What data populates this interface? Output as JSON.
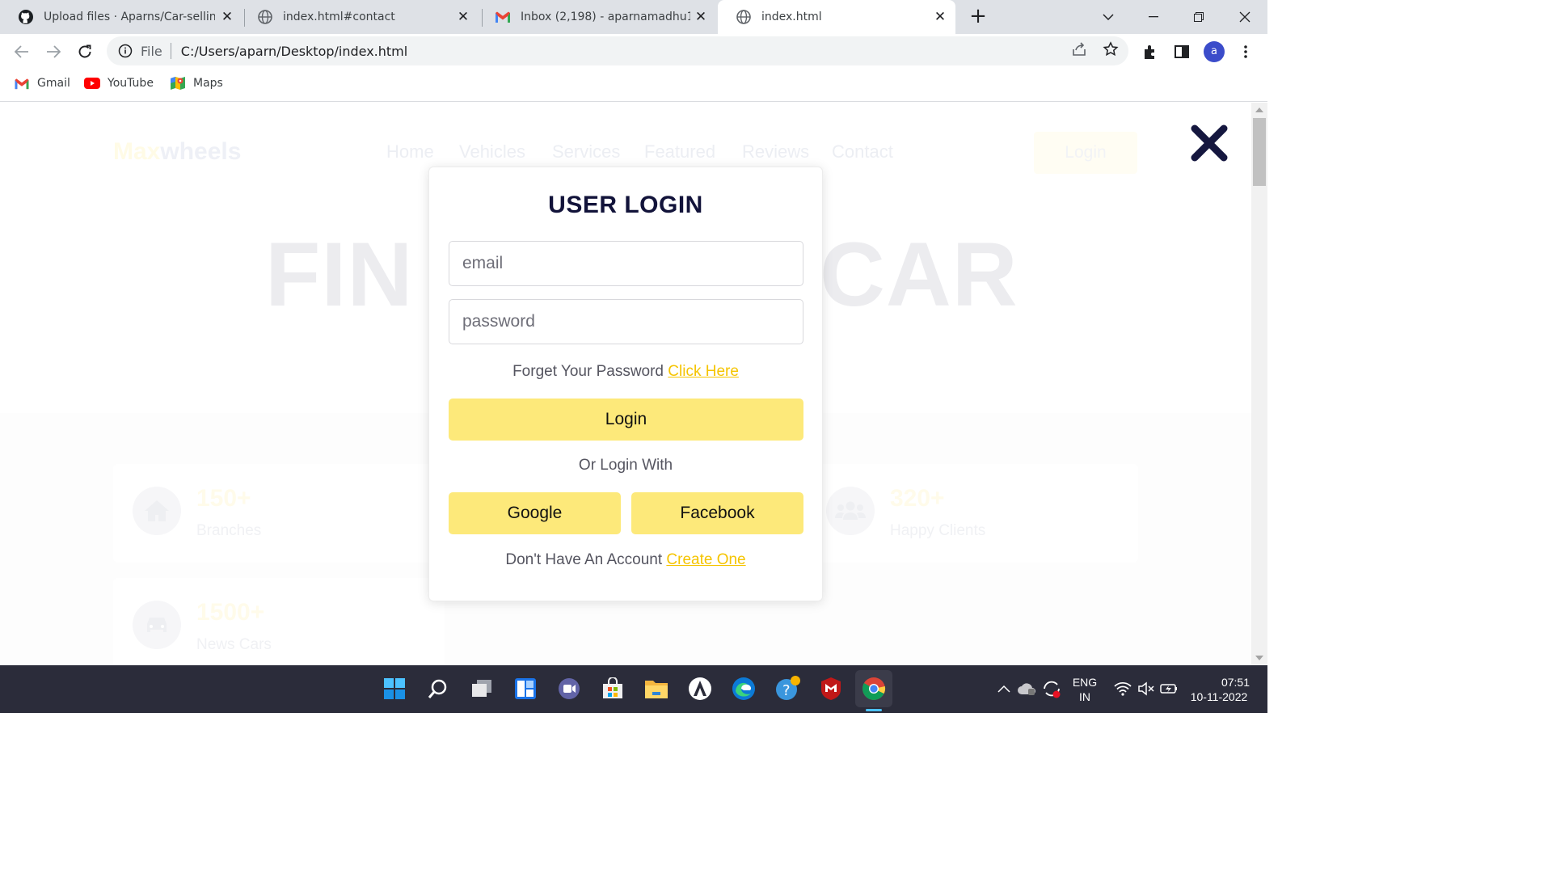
{
  "browser": {
    "tabs": [
      {
        "title": "Upload files · Aparns/Car-selling-",
        "icon": "github-icon"
      },
      {
        "title": "index.html#contact",
        "icon": "globe-icon"
      },
      {
        "title": "Inbox (2,198) - aparnamadhu101",
        "icon": "gmail-icon"
      },
      {
        "title": "index.html",
        "icon": "globe-icon",
        "active": true
      }
    ],
    "address": {
      "scheme": "File",
      "url": "C:/Users/aparn/Desktop/index.html"
    },
    "profile_initial": "a",
    "bookmarks": [
      {
        "label": "Gmail",
        "icon": "gmail-icon"
      },
      {
        "label": "YouTube",
        "icon": "youtube-icon"
      },
      {
        "label": "Maps",
        "icon": "maps-icon"
      }
    ]
  },
  "site": {
    "logo": {
      "part1": "Max",
      "part2": "wheels"
    },
    "nav": [
      "Home",
      "Vehicles",
      "Services",
      "Featured",
      "Reviews",
      "Contact"
    ],
    "login_button": "Login",
    "hero_left": "FIN",
    "hero_right": "CAR",
    "stats": [
      {
        "value": "150+",
        "label": "Branches",
        "icon": "home-icon"
      },
      {
        "value": "320+",
        "label": "Happy Clients",
        "icon": "users-icon"
      },
      {
        "value": "1500+",
        "label": "News Cars",
        "icon": "car-icon"
      }
    ]
  },
  "modal": {
    "title": "USER LOGIN",
    "email_placeholder": "email",
    "password_placeholder": "password",
    "forgot_text": "Forget Your Password",
    "forgot_link": "Click Here",
    "login_button": "Login",
    "or_text": "Or Login With",
    "google_button": "Google",
    "facebook_button": "Facebook",
    "no_account_text": "Don't Have An Account",
    "create_link": "Create One"
  },
  "taskbar": {
    "lang_top": "ENG",
    "lang_bottom": "IN",
    "time": "07:51",
    "date": "10-11-2022"
  },
  "colors": {
    "accent_yellow": "#fde97a",
    "link_yellow": "#f5c400",
    "title_navy": "#12133a",
    "close_navy": "#15173f",
    "taskbar": "#2b2c3a"
  }
}
